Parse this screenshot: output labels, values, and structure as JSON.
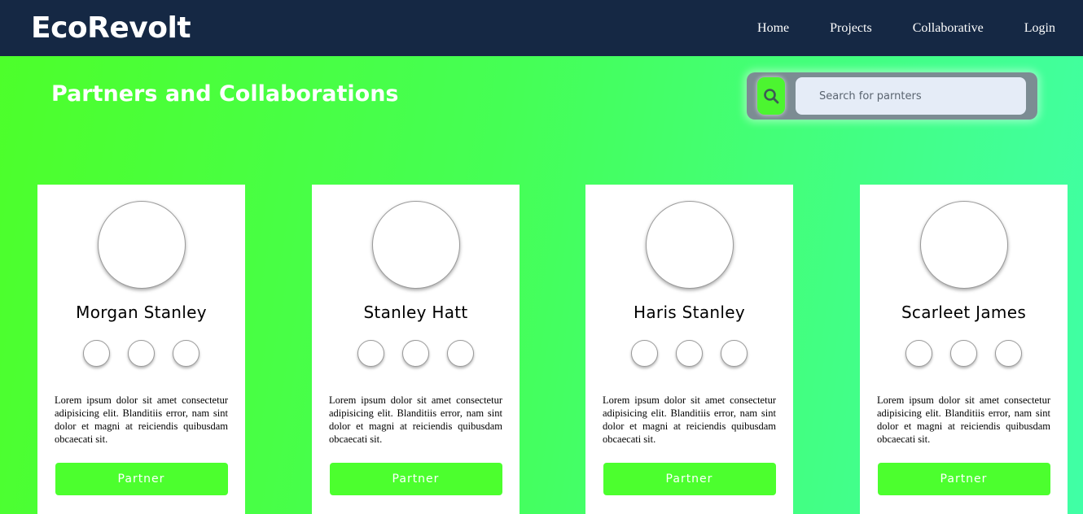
{
  "navbar": {
    "brand": "EcoRevolt",
    "links": [
      "Home",
      "Projects",
      "Collaborative",
      "Login"
    ]
  },
  "page": {
    "title": "Partners and Collaborations"
  },
  "search": {
    "placeholder": "Search for parnters",
    "icon": "search-icon"
  },
  "cards": [
    {
      "name": "Morgan Stanley",
      "description": "Lorem ipsum dolor sit amet consectetur adipisicing elit. Blanditiis error, nam sint dolor et magni at reiciendis quibusdam obcaecati sit.",
      "button": "Partner"
    },
    {
      "name": "Stanley Hatt",
      "description": "Lorem ipsum dolor sit amet consectetur adipisicing elit. Blanditiis error, nam sint dolor et magni at reiciendis quibusdam obcaecati sit.",
      "button": "Partner"
    },
    {
      "name": "Haris Stanley",
      "description": "Lorem ipsum dolor sit amet consectetur adipisicing elit. Blanditiis error, nam sint dolor et magni at reiciendis quibusdam obcaecati sit.",
      "button": "Partner"
    },
    {
      "name": "Scarleet James",
      "description": "Lorem ipsum dolor sit amet consectetur adipisicing elit. Blanditiis error, nam sint dolor et magni at reiciendis quibusdam obcaecati sit.",
      "button": "Partner"
    }
  ],
  "colors": {
    "navbar": "#152844",
    "accent": "#4cff2e",
    "gradient_start": "#4dff2a",
    "gradient_end": "#40ffa6"
  }
}
